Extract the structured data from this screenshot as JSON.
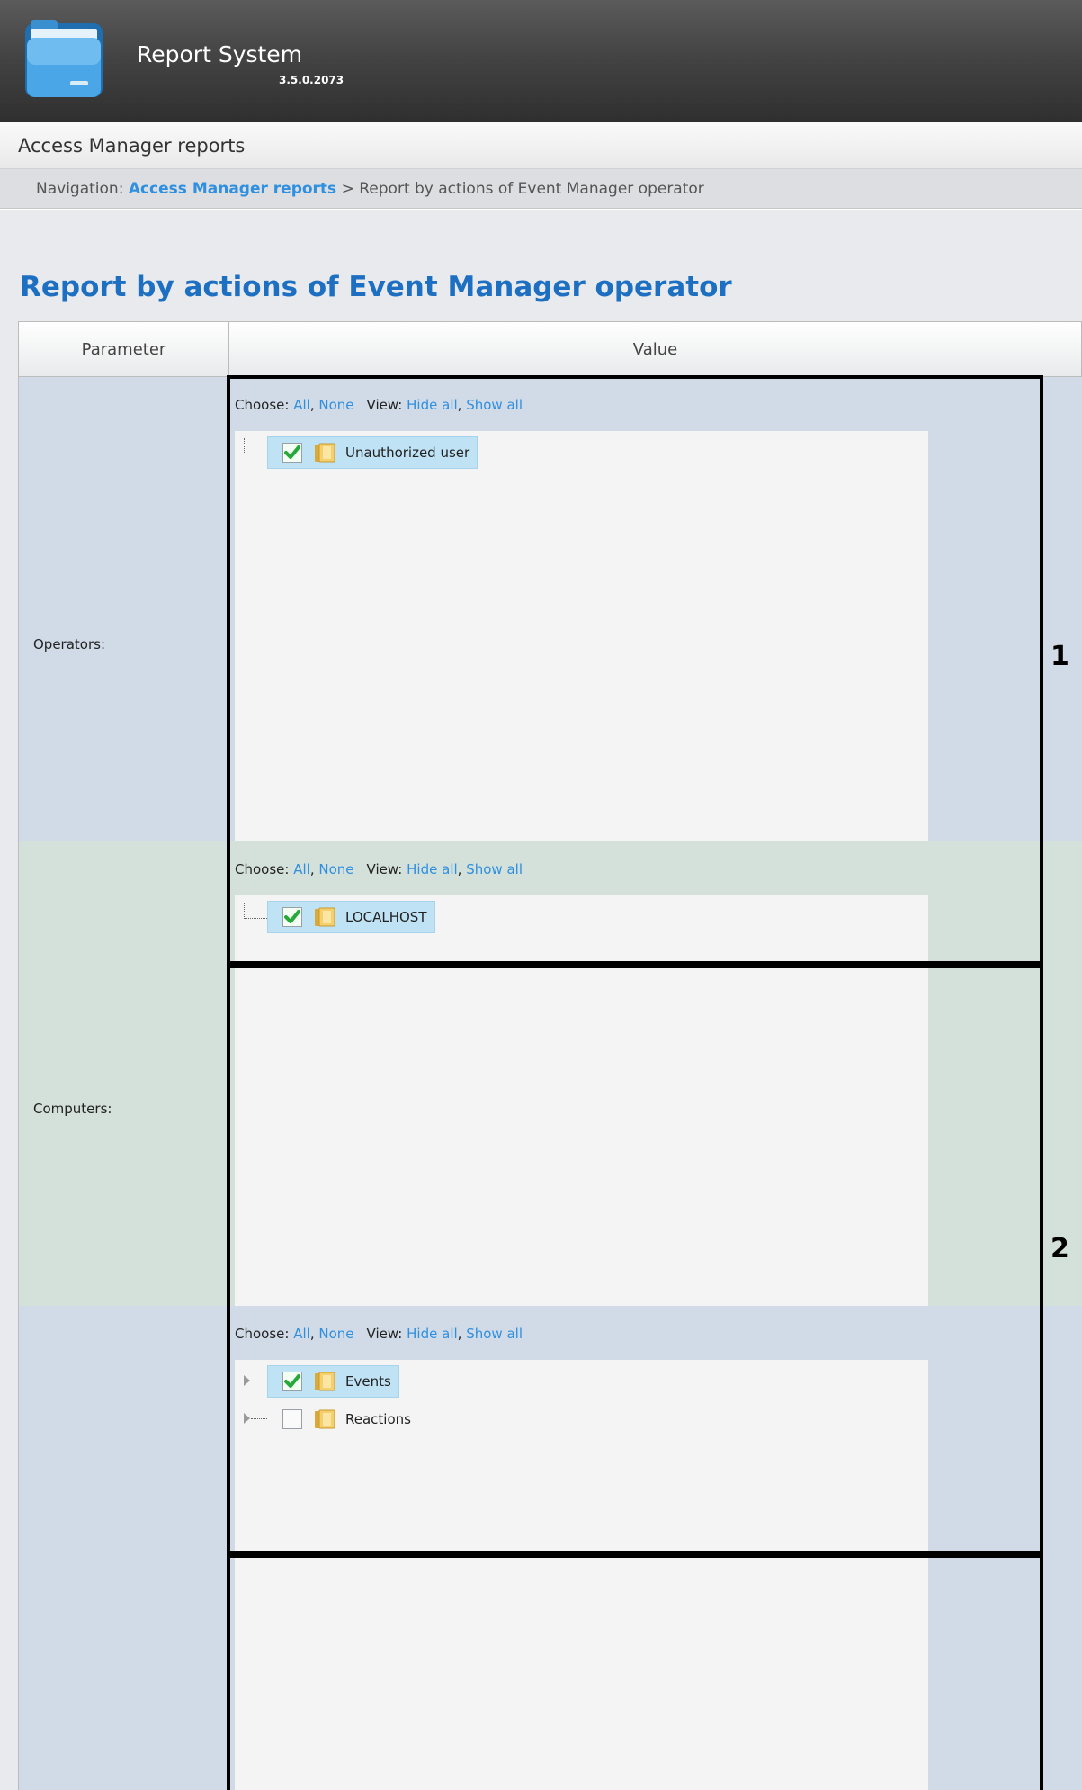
{
  "header": {
    "title": "Report System",
    "version": "3.5.0.2073",
    "icon": "folder-app-icon"
  },
  "section": {
    "title": "Access Manager reports"
  },
  "breadcrumb": {
    "prefix": "Navigation:",
    "link": "Access Manager reports",
    "separator": ">",
    "current": "Report by actions of Event Manager operator"
  },
  "report": {
    "title": "Report by actions of Event Manager operator",
    "columns": {
      "parameter": "Parameter",
      "value": "Value"
    }
  },
  "tree_controls": {
    "choose_label": "Choose:",
    "all": "All",
    "sep": ",",
    "none": "None",
    "view_label": "View:",
    "hide_all": "Hide all",
    "show_all": "Show all"
  },
  "rows": [
    {
      "label": "Operators:",
      "callout": "1",
      "nodes": [
        {
          "label": "Unauthorized user",
          "checked": true,
          "selected": true,
          "expandable": false
        }
      ]
    },
    {
      "label": "Computers:",
      "callout": "2",
      "nodes": [
        {
          "label": "LOCALHOST",
          "checked": true,
          "selected": true,
          "expandable": false
        }
      ]
    },
    {
      "label": "",
      "callout": "",
      "nodes": [
        {
          "label": "Events",
          "checked": true,
          "selected": true,
          "expandable": true
        },
        {
          "label": "Reactions",
          "checked": false,
          "selected": false,
          "expandable": true
        }
      ]
    }
  ],
  "colors": {
    "header_dark": "#3a3a3a",
    "link_blue": "#2f8fe0",
    "title_blue": "#1d6fc2",
    "row_blue": "#d1dbe7",
    "row_green": "#d4e1da",
    "selection": "#bfe3f5"
  }
}
